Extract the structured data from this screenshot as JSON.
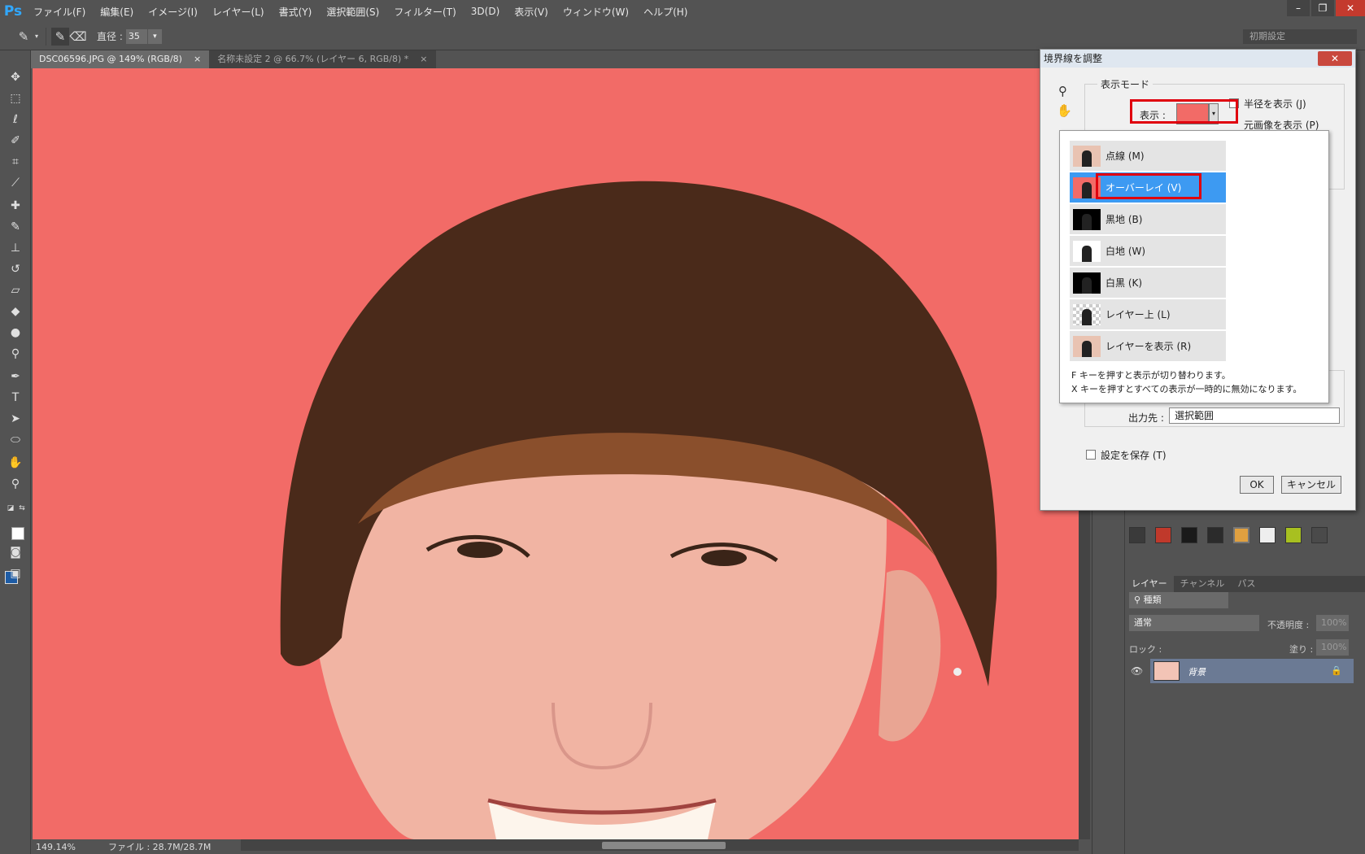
{
  "app": {
    "logo": "Ps",
    "menu": [
      "ファイル(F)",
      "編集(E)",
      "イメージ(I)",
      "レイヤー(L)",
      "書式(Y)",
      "選択範囲(S)",
      "フィルター(T)",
      "3D(D)",
      "表示(V)",
      "ウィンドウ(W)",
      "ヘルプ(H)"
    ],
    "window_controls": {
      "minimize": "–",
      "restore": "❐",
      "close": "✕"
    }
  },
  "options": {
    "diameter_label": "直径 :",
    "diameter_value": "35",
    "workspace": "初期設定"
  },
  "tabs": [
    {
      "label": "DSC06596.JPG @ 149% (RGB/8)",
      "close": "×"
    },
    {
      "label": "名称未設定 2 @ 66.7% (レイヤー 6, RGB/8) *",
      "close": "×"
    }
  ],
  "status": {
    "zoom": "149.14%",
    "file": "ファイル : 28.7M/28.7M"
  },
  "dialog": {
    "title": "境界線を調整",
    "close": "✕",
    "view_mode_label": "表示モード",
    "view_label": "表示 :",
    "show_radius": "半径を表示 (J)",
    "show_original": "元画像を表示 (P)",
    "dropdown_items": [
      {
        "label": "点線 (M)",
        "thumb": "marching"
      },
      {
        "label": "オーバーレイ (V)",
        "thumb": "overlay"
      },
      {
        "label": "黒地 (B)",
        "thumb": "black"
      },
      {
        "label": "白地 (W)",
        "thumb": "white"
      },
      {
        "label": "白黒 (K)",
        "thumb": "bw"
      },
      {
        "label": "レイヤー上 (L)",
        "thumb": "layer"
      },
      {
        "label": "レイヤーを表示 (R)",
        "thumb": "reveal"
      }
    ],
    "hint1": "F キーを押すと表示が切り替わります。",
    "hint2": "X キーを押すとすべての表示が一時的に無効になります。",
    "output_label": "出力先 :",
    "output_value": "選択範囲",
    "remember": "設定を保存 (T)",
    "ok": "OK",
    "cancel": "キャンセル"
  },
  "layers": {
    "tabs": [
      "レイヤー",
      "チャンネル",
      "パス"
    ],
    "filter": "種類",
    "blend": "通常",
    "opacity_label": "不透明度 :",
    "opacity_value": "100%",
    "lock_label": "ロック :",
    "fill_label": "塗り :",
    "fill_value": "100%",
    "layer_name": "背景"
  },
  "colors": {
    "foreground": "#1e5ca5",
    "background": "#ffffff",
    "overlay_red": "#f26b67",
    "selection_blue": "#3d9af2"
  }
}
